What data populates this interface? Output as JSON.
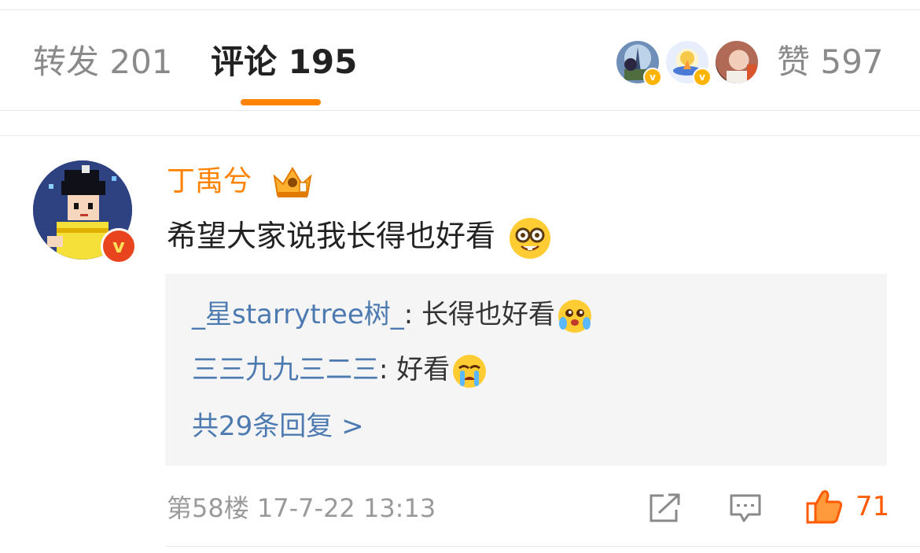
{
  "tabs": {
    "repost_label": "转发 201",
    "comment_label": "评论 195",
    "like_label": "赞 597"
  },
  "comment": {
    "username": "丁禹兮",
    "text": "希望大家说我长得也好看",
    "replies": [
      {
        "name": "_星starrytree树_",
        "text": ": 长得也好看"
      },
      {
        "name": "三三九九三二三",
        "text": ": 好看"
      }
    ],
    "more_replies": "共29条回复 >",
    "meta": "第58楼  17-7-22 13:13",
    "like_count": "71"
  },
  "colors": {
    "accent": "#ff8200",
    "link": "#4d7ab0",
    "like": "#ff5b00"
  },
  "icons": {
    "share": "share-icon",
    "comment": "comment-icon",
    "like": "thumb-up-icon",
    "crown": "crown-icon",
    "verified": "verified-icon"
  }
}
